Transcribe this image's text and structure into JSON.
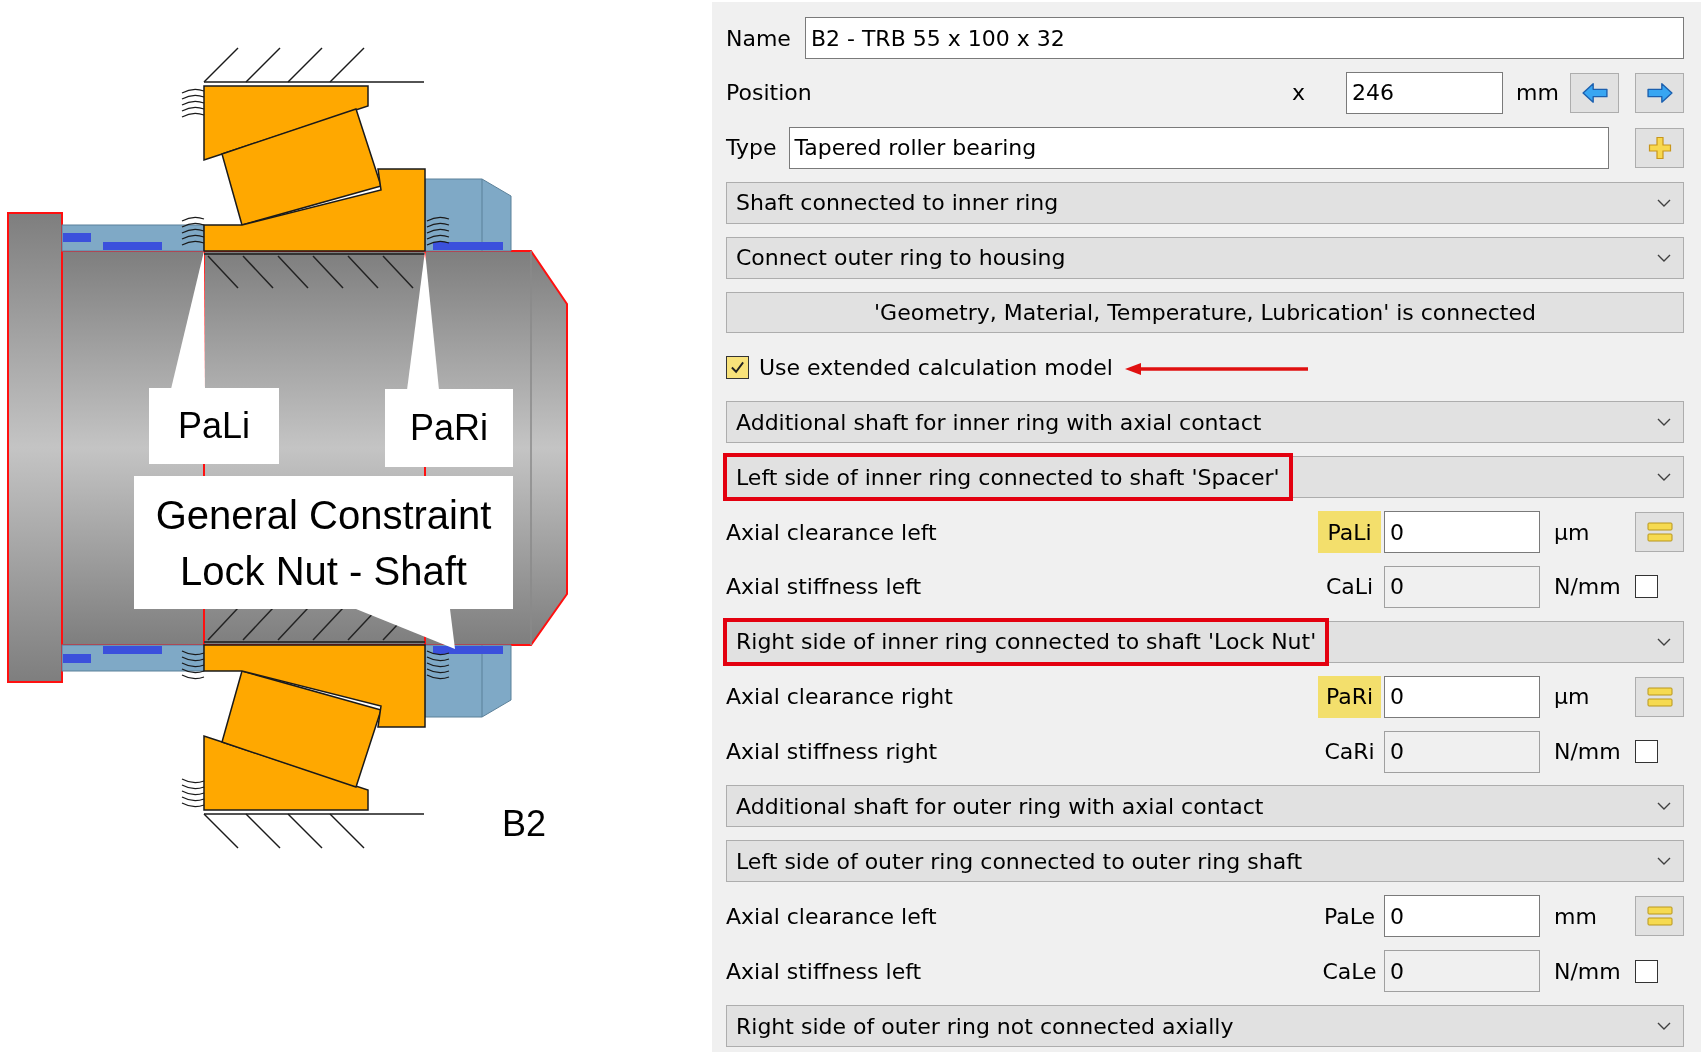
{
  "diagram": {
    "callouts": [
      {
        "lines": [
          "PaLi"
        ]
      },
      {
        "lines": [
          "PaRi"
        ]
      },
      {
        "lines": [
          "General Constraint",
          "Lock Nut - Shaft"
        ]
      }
    ],
    "label": "B2"
  },
  "form": {
    "rows": [
      {
        "kind": "text_field",
        "label": "Name",
        "value": "B2 - TRB 55 x 100 x 32"
      },
      {
        "kind": "position",
        "label": "Position",
        "axis": "x",
        "value": "246",
        "unit": "mm"
      },
      {
        "kind": "field_with_add",
        "label": "Type",
        "value": "Tapered roller bearing"
      },
      {
        "kind": "dropdown",
        "value": "Shaft connected to inner ring",
        "highlighted": false
      },
      {
        "kind": "dropdown",
        "value": "Connect outer ring to housing",
        "highlighted": false
      },
      {
        "kind": "button",
        "label": "'Geometry, Material, Temperature, Lubrication' is connected"
      },
      {
        "kind": "checkbox",
        "label": "Use extended calculation model",
        "checked": true,
        "pointer_arrow": true
      },
      {
        "kind": "dropdown",
        "value": "Additional shaft for inner ring with axial contact",
        "highlighted": false
      },
      {
        "kind": "dropdown",
        "value": "Left side of inner ring connected to shaft 'Spacer'",
        "highlighted": true
      },
      {
        "kind": "clearance",
        "label": "Axial clearance left",
        "symbol": "PaLi",
        "highlighted": true,
        "value": "0",
        "unit": "µm"
      },
      {
        "kind": "stiffness",
        "label": "Axial stiffness left",
        "symbol": "CaLi",
        "value": "0",
        "unit": "N/mm",
        "disabled": true,
        "checked": false
      },
      {
        "kind": "dropdown",
        "value": "Right side of inner ring connected to shaft 'Lock Nut'",
        "highlighted": true
      },
      {
        "kind": "clearance",
        "label": "Axial clearance right",
        "symbol": "PaRi",
        "highlighted": true,
        "value": "0",
        "unit": "µm"
      },
      {
        "kind": "stiffness",
        "label": "Axial stiffness right",
        "symbol": "CaRi",
        "value": "0",
        "unit": "N/mm",
        "disabled": true,
        "checked": false
      },
      {
        "kind": "dropdown",
        "value": "Additional shaft for outer ring with axial contact",
        "highlighted": false
      },
      {
        "kind": "dropdown",
        "value": "Left side of outer ring connected to outer ring shaft",
        "highlighted": false
      },
      {
        "kind": "clearance",
        "label": "Axial clearance left",
        "symbol": "PaLe",
        "highlighted": false,
        "value": "0",
        "unit": "mm"
      },
      {
        "kind": "stiffness",
        "label": "Axial stiffness left",
        "symbol": "CaLe",
        "value": "0",
        "unit": "N/mm",
        "disabled": true,
        "checked": false
      },
      {
        "kind": "dropdown",
        "value": "Right side of outer ring not connected axially",
        "highlighted": false
      }
    ]
  }
}
